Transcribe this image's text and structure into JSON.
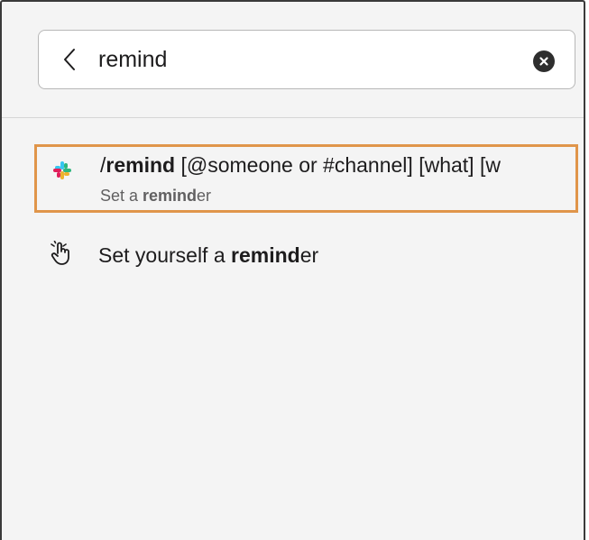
{
  "search": {
    "value": "remind",
    "back_icon": "chevron-left-icon",
    "clear_icon": "close-circle-icon"
  },
  "results": [
    {
      "icon": "slack-logo-icon",
      "slash": "/",
      "match": "remind",
      "rest": " [@someone or #channel] [what] [w",
      "desc_prefix": "Set a ",
      "desc_match": "remind",
      "desc_suffix": "er",
      "highlighted": true
    },
    {
      "icon": "hand-pointer-icon",
      "prefix": "Set yourself a ",
      "match": "remind",
      "suffix": "er"
    }
  ],
  "colors": {
    "highlight_border": "#e0954a",
    "panel_bg": "#f4f4f4",
    "text": "#1d1c1d",
    "muted_text": "#616061",
    "logo_blue": "#36c5f0",
    "logo_green": "#2eb67d",
    "logo_yellow": "#ecb22e",
    "logo_red": "#e01e5a"
  }
}
